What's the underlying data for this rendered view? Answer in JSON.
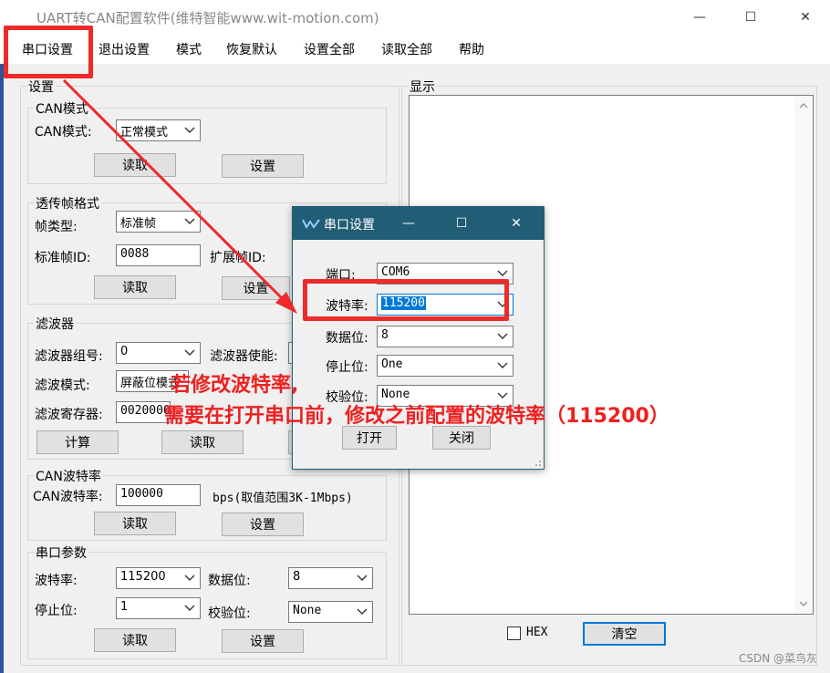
{
  "window": {
    "title": "UART转CAN配置软件(维特智能www.wit-motion.com)",
    "minimize_glyph": "—",
    "maximize_glyph": "☐",
    "close_glyph": "✕"
  },
  "menu": {
    "items": [
      "串口设置",
      "退出设置",
      "模式",
      "恢复默认",
      "设置全部",
      "读取全部",
      "帮助"
    ]
  },
  "settings_group": {
    "title": "设置"
  },
  "can_mode": {
    "title": "CAN模式",
    "label": "CAN模式:",
    "value": "正常模式",
    "read": "读取",
    "set": "设置"
  },
  "passthrough": {
    "title": "透传帧格式",
    "frame_type_label": "帧类型:",
    "frame_type_value": "标准帧",
    "std_id_label": "标准帧ID:",
    "std_id_value": "0088",
    "ext_id_label": "扩展帧ID:",
    "read": "读取",
    "set": "设置"
  },
  "filter": {
    "title": "滤波器",
    "group_label": "滤波器组号:",
    "group_value": "0",
    "enable_label": "滤波器使能:",
    "mode_label": "滤波模式:",
    "mode_value": "屏蔽位模式",
    "reg_label": "滤波寄存器:",
    "reg_value": "00200000",
    "calc": "计算",
    "read": "读取"
  },
  "can_baud": {
    "title": "CAN波特率",
    "label": "CAN波特率:",
    "value": "100000",
    "hint": "bps(取值范围3K-1Mbps)",
    "read": "读取",
    "set": "设置"
  },
  "serial_params": {
    "title": "串口参数",
    "baud_label": "波特率:",
    "baud_value": "115200",
    "data_label": "数据位:",
    "data_value": "8",
    "stop_label": "停止位:",
    "stop_value": "1",
    "parity_label": "校验位:",
    "parity_value": "None",
    "read": "读取",
    "set": "设置"
  },
  "display": {
    "title": "显示",
    "hex_label": "HEX",
    "clear": "清空"
  },
  "dialog": {
    "title": "串口设置",
    "port_label": "端口:",
    "port_value": "COM6",
    "baud_label": "波特率:",
    "baud_value": "115200",
    "data_label": "数据位:",
    "data_value": "8",
    "stop_label": "停止位:",
    "stop_value": "One",
    "parity_label": "校验位:",
    "parity_value": "None",
    "open": "打开",
    "close": "关闭"
  },
  "annotation": {
    "line1": "若修改波特率,",
    "line2": "需要在打开串口前，修改之前配置的波特率（115200）",
    "color": "#ee2020"
  },
  "watermark": "CSDN @菜鸟灰"
}
